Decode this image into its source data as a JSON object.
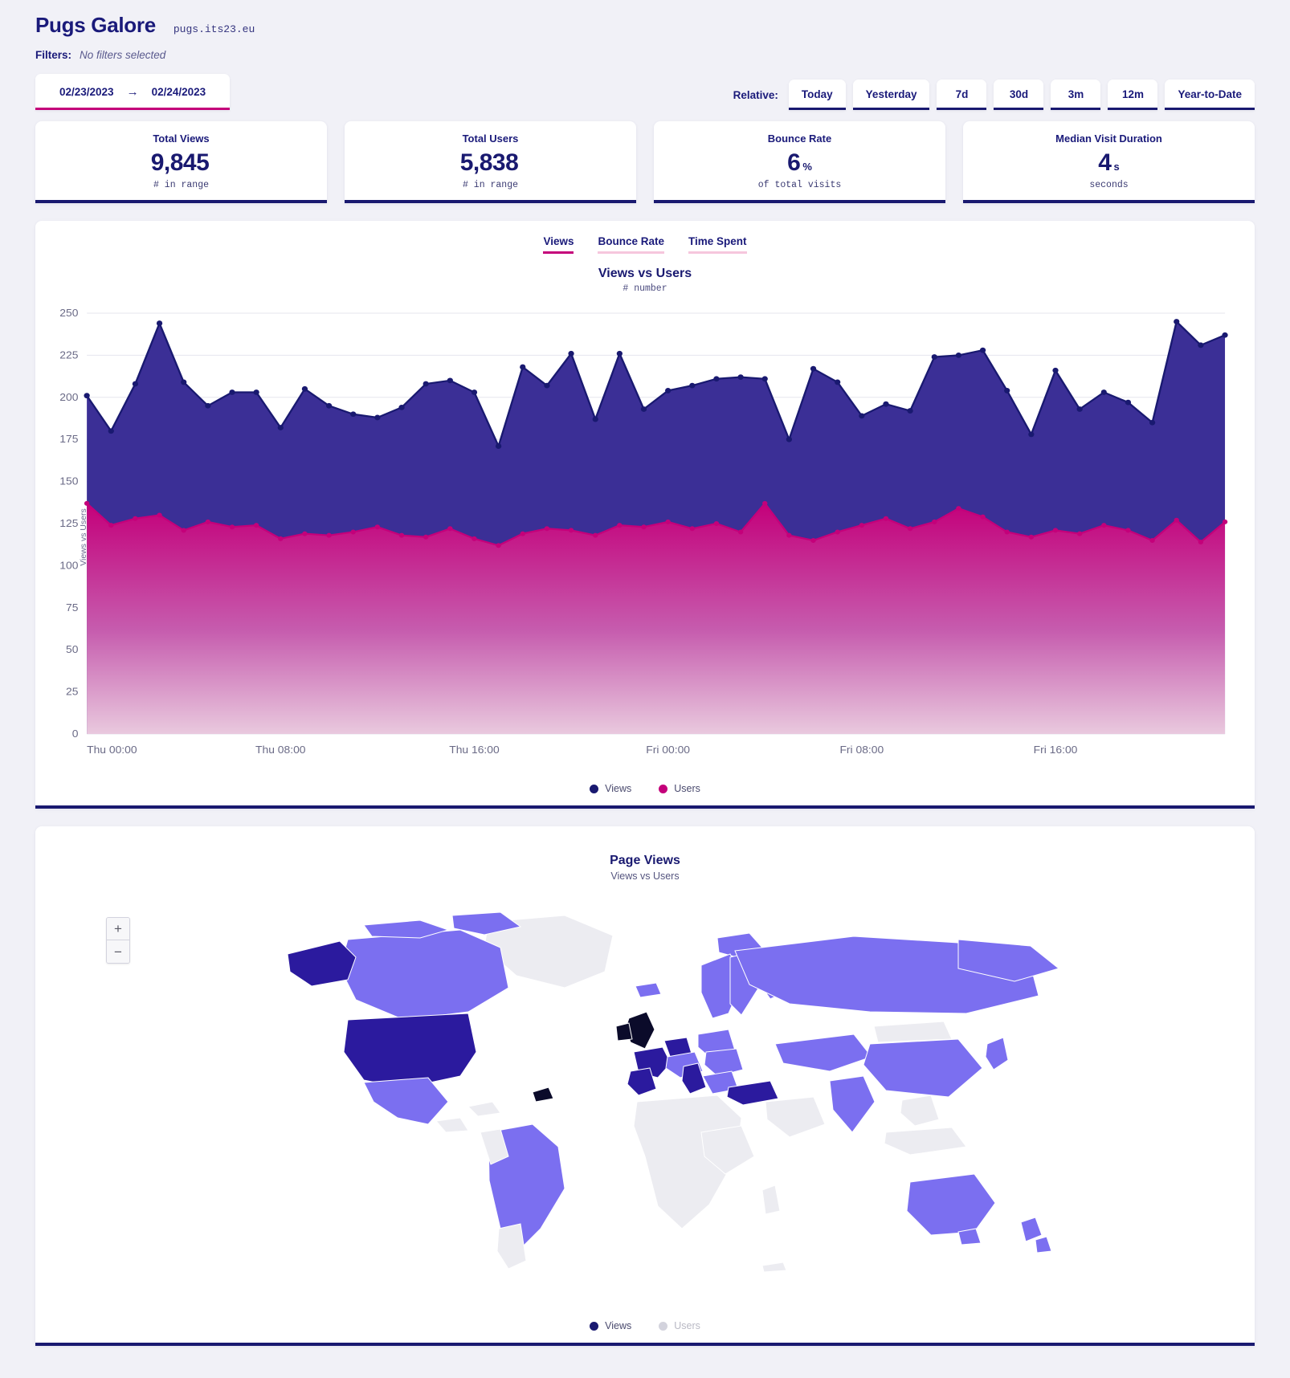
{
  "header": {
    "app_title": "Pugs Galore",
    "domain": "pugs.its23.eu",
    "filters_label": "Filters:",
    "filters_value": "No filters selected"
  },
  "date_range": {
    "start": "02/23/2023",
    "arrow": "→",
    "end": "02/24/2023"
  },
  "relative": {
    "label": "Relative:",
    "buttons": [
      {
        "label": "Today"
      },
      {
        "label": "Yesterday"
      },
      {
        "label": "7d"
      },
      {
        "label": "30d"
      },
      {
        "label": "3m"
      },
      {
        "label": "12m"
      },
      {
        "label": "Year-to-Date"
      }
    ]
  },
  "stats": [
    {
      "label": "Total Views",
      "value": "9,845",
      "unit": "",
      "sub": "# in range"
    },
    {
      "label": "Total Users",
      "value": "5,838",
      "unit": "",
      "sub": "# in range"
    },
    {
      "label": "Bounce Rate",
      "value": "6",
      "unit": "%",
      "sub": "of total visits"
    },
    {
      "label": "Median Visit Duration",
      "value": "4",
      "unit": "s",
      "sub": "seconds"
    }
  ],
  "chart_panel": {
    "tabs": [
      {
        "label": "Views",
        "active": true
      },
      {
        "label": "Bounce Rate",
        "active": false
      },
      {
        "label": "Time Spent",
        "active": false
      }
    ],
    "title": "Views vs Users",
    "subtitle": "# number",
    "legend": [
      {
        "label": "Views",
        "color": "#191970",
        "muted": false
      },
      {
        "label": "Users",
        "color": "#c4007a",
        "muted": false
      }
    ]
  },
  "map_panel": {
    "title": "Page Views",
    "subtitle": "Views vs Users",
    "zoom_in": "+",
    "zoom_out": "−",
    "legend": [
      {
        "label": "Views",
        "color": "#191970",
        "muted": false
      },
      {
        "label": "Users",
        "color": "#d3d3dd",
        "muted": true
      }
    ]
  },
  "colors": {
    "accent_navy": "#191970",
    "accent_magenta": "#c4007a",
    "page_bg": "#f1f1f7",
    "card_bg": "#ffffff",
    "map_land": "#ececf1",
    "map_high": "#2b1a9e",
    "map_mid": "#6b5fe8",
    "map_top": "#0b0b2a"
  },
  "chart_data": {
    "type": "area",
    "title": "Views vs Users",
    "subtitle": "# number",
    "xlabel": "",
    "ylabel": "Views vs Users",
    "ylim": [
      0,
      250
    ],
    "yticks": [
      0,
      25,
      50,
      75,
      100,
      125,
      150,
      175,
      200,
      225,
      250
    ],
    "xticks": [
      "Thu 00:00",
      "Thu 08:00",
      "Thu 16:00",
      "Fri 00:00",
      "Fri 08:00",
      "Fri 16:00"
    ],
    "grid": true,
    "legend_position": "bottom",
    "x": [
      "Thu 00:00",
      "Thu 01:00",
      "Thu 02:00",
      "Thu 03:00",
      "Thu 04:00",
      "Thu 05:00",
      "Thu 06:00",
      "Thu 07:00",
      "Thu 08:00",
      "Thu 09:00",
      "Thu 10:00",
      "Thu 11:00",
      "Thu 12:00",
      "Thu 13:00",
      "Thu 14:00",
      "Thu 15:00",
      "Thu 16:00",
      "Thu 17:00",
      "Thu 18:00",
      "Thu 19:00",
      "Thu 20:00",
      "Thu 21:00",
      "Thu 22:00",
      "Thu 23:00",
      "Fri 00:00",
      "Fri 01:00",
      "Fri 02:00",
      "Fri 03:00",
      "Fri 04:00",
      "Fri 05:00",
      "Fri 06:00",
      "Fri 07:00",
      "Fri 08:00",
      "Fri 09:00",
      "Fri 10:00",
      "Fri 11:00",
      "Fri 12:00",
      "Fri 13:00",
      "Fri 14:00",
      "Fri 15:00",
      "Fri 16:00",
      "Fri 17:00",
      "Fri 18:00",
      "Fri 19:00",
      "Fri 20:00",
      "Fri 21:00",
      "Fri 22:00",
      "Fri 23:00"
    ],
    "series": [
      {
        "name": "Views",
        "color": "#191970",
        "values": [
          201,
          180,
          208,
          244,
          209,
          195,
          203,
          203,
          182,
          205,
          195,
          190,
          188,
          194,
          208,
          210,
          203,
          171,
          218,
          207,
          226,
          187,
          226,
          193,
          204,
          207,
          211,
          212,
          211,
          175,
          217,
          209,
          189,
          196,
          192,
          224,
          225,
          228,
          204,
          178,
          216,
          193,
          203,
          197,
          185,
          245,
          231,
          237
        ]
      },
      {
        "name": "Users",
        "color": "#c4007a",
        "values": [
          137,
          124,
          128,
          130,
          121,
          126,
          123,
          124,
          116,
          119,
          118,
          120,
          123,
          118,
          117,
          122,
          116,
          112,
          119,
          122,
          121,
          118,
          124,
          123,
          126,
          122,
          125,
          120,
          137,
          118,
          115,
          120,
          124,
          128,
          122,
          126,
          134,
          129,
          120,
          117,
          121,
          119,
          124,
          121,
          115,
          127,
          114,
          126
        ]
      }
    ]
  }
}
